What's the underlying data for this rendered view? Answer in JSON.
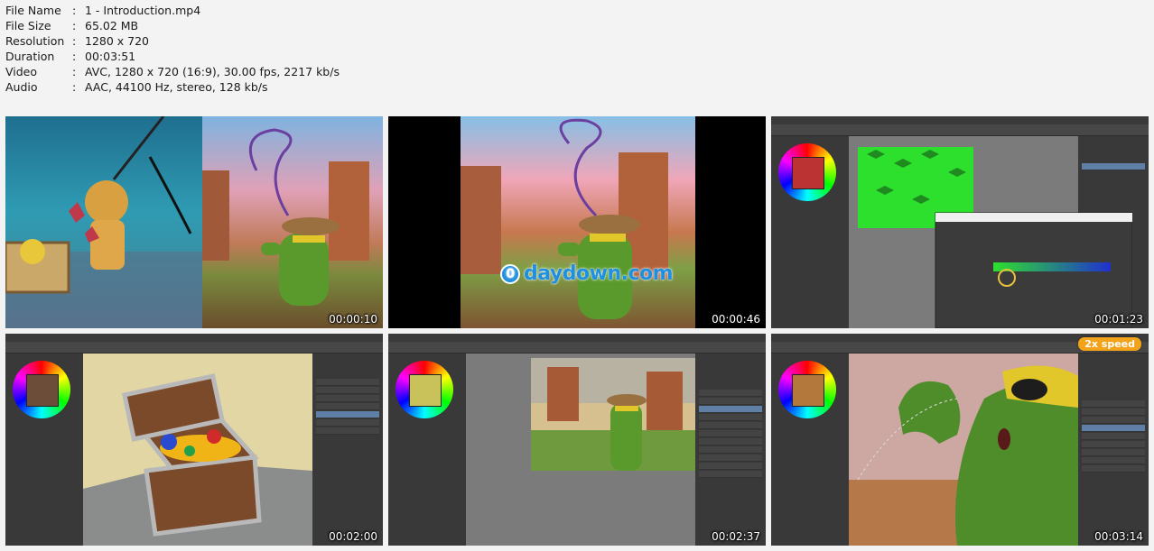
{
  "info": [
    {
      "label": "File Name",
      "value": "1 - Introduction.mp4"
    },
    {
      "label": "File Size",
      "value": "65.02 MB"
    },
    {
      "label": "Resolution",
      "value": "1280 x 720"
    },
    {
      "label": "Duration",
      "value": "00:03:51"
    },
    {
      "label": "Video",
      "value": "AVC, 1280 x 720 (16:9), 30.00 fps, 2217 kb/s"
    },
    {
      "label": "Audio",
      "value": "AAC, 44100 Hz, stereo, 128 kb/s"
    }
  ],
  "separator": ":",
  "thumbnails": [
    {
      "timestamp": "00:00:10"
    },
    {
      "timestamp": "00:00:46",
      "watermark": "daydown.com",
      "watermark_icon": "0"
    },
    {
      "timestamp": "00:01:23"
    },
    {
      "timestamp": "00:02:00"
    },
    {
      "timestamp": "00:02:37"
    },
    {
      "timestamp": "00:03:14",
      "badge": "2x speed"
    }
  ]
}
